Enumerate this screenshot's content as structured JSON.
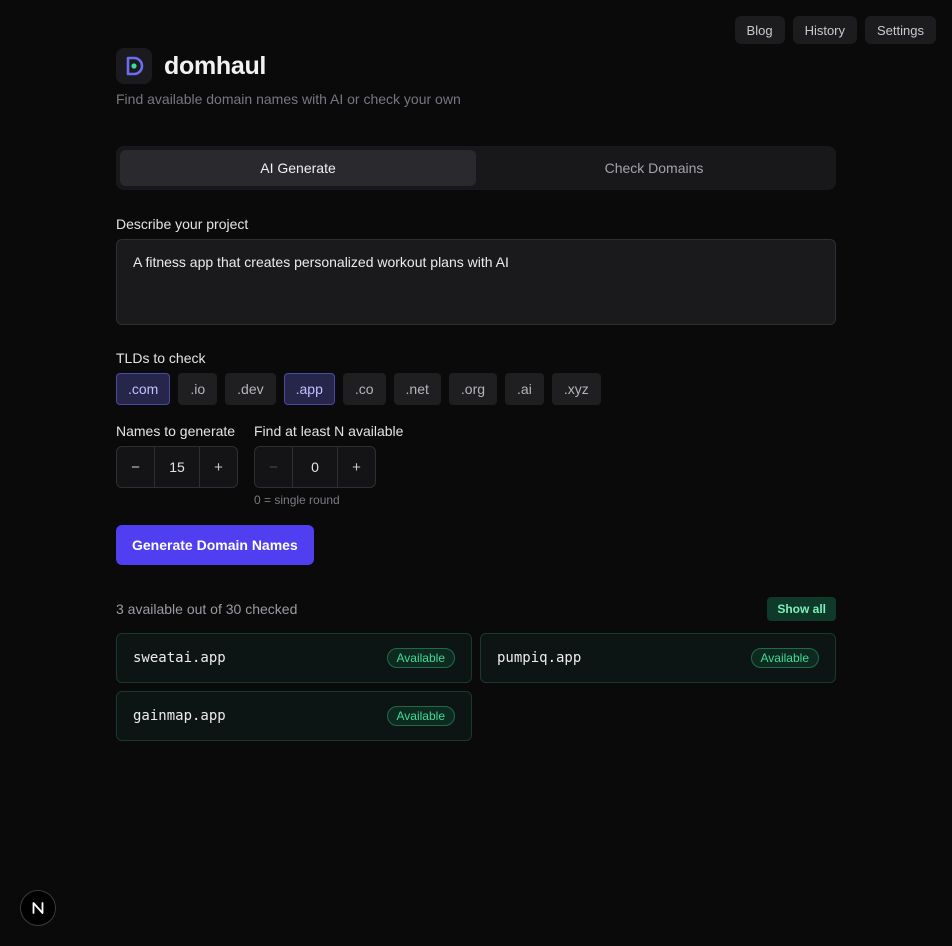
{
  "nav": {
    "blog": "Blog",
    "history": "History",
    "settings": "Settings"
  },
  "brand": {
    "name": "domhaul",
    "tagline": "Find available domain names with AI or check your own"
  },
  "tabs": [
    {
      "label": "AI Generate",
      "active": true
    },
    {
      "label": "Check Domains",
      "active": false
    }
  ],
  "project": {
    "label": "Describe your project",
    "value": "A fitness app that creates personalized workout plans with AI"
  },
  "tlds": {
    "label": "TLDs to check",
    "items": [
      {
        "label": ".com",
        "selected": true
      },
      {
        "label": ".io",
        "selected": false
      },
      {
        "label": ".dev",
        "selected": false
      },
      {
        "label": ".app",
        "selected": true
      },
      {
        "label": ".co",
        "selected": false
      },
      {
        "label": ".net",
        "selected": false
      },
      {
        "label": ".org",
        "selected": false
      },
      {
        "label": ".ai",
        "selected": false
      },
      {
        "label": ".xyz",
        "selected": false
      }
    ]
  },
  "names_to_generate": {
    "label": "Names to generate",
    "value": "15",
    "minus": "−",
    "plus": "+"
  },
  "find_available": {
    "label": "Find at least N available",
    "value": "0",
    "minus": "−",
    "plus": "+",
    "hint": "0 = single round"
  },
  "generate_button": "Generate Domain Names",
  "results": {
    "summary": "3 available out of 30 checked",
    "show_all": "Show all",
    "items": [
      {
        "domain": "sweatai.app",
        "status": "Available"
      },
      {
        "domain": "pumpiq.app",
        "status": "Available"
      },
      {
        "domain": "gainmap.app",
        "status": "Available"
      }
    ]
  },
  "colors": {
    "accent": "#4f3ff0",
    "available": "#3ddc97",
    "background": "#0a0a0b"
  },
  "icons": {
    "logo": "domhaul-logo-icon",
    "dev_badge": "nextjs-icon"
  }
}
